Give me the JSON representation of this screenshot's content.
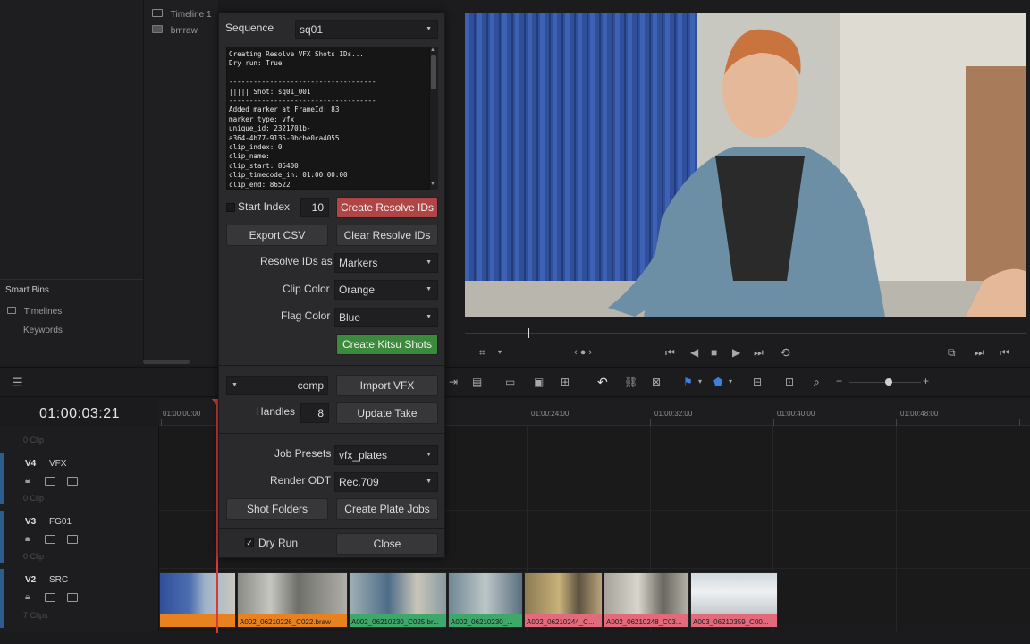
{
  "media_pool": {
    "top_items": [
      "Timeline 1",
      "bmraw"
    ],
    "smart_bins_title": "Smart Bins",
    "smart_bins": [
      "Timelines",
      "Keywords"
    ]
  },
  "dialog": {
    "sequence_label": "Sequence",
    "sequence_value": "sq01",
    "log_text": "Creating Resolve VFX Shots IDs...\nDry run: True\n\n------------------------------------\n||||| Shot: sq01_001\n------------------------------------\nAdded marker at FrameId: 83\nmarker_type: vfx\nunique_id: 2321701b-\na364-4b77-9135-0bcbe0ca4055\nclip_index: 0\nclip_name:\nclip_start: 86400\nclip_timecode_in: 01:00:00:00\nclip_end: 86522",
    "start_index_label": "Start Index",
    "start_index_value": "10",
    "create_resolve_ids_label": "Create Resolve IDs",
    "export_csv_label": "Export CSV",
    "clear_resolve_ids_label": "Clear Resolve IDs",
    "resolve_ids_as_label": "Resolve IDs as",
    "resolve_ids_as_value": "Markers",
    "clip_color_label": "Clip Color",
    "clip_color_value": "Orange",
    "flag_color_label": "Flag Color",
    "flag_color_value": "Blue",
    "create_kitsu_shots_label": "Create Kitsu Shots",
    "task_value": "comp",
    "import_vfx_label": "Import VFX",
    "handles_label": "Handles",
    "handles_value": "8",
    "update_take_label": "Update Take",
    "job_presets_label": "Job Presets",
    "job_presets_value": "vfx_plates",
    "render_odt_label": "Render ODT",
    "render_odt_value": "Rec.709",
    "shot_folders_label": "Shot Folders",
    "create_plate_jobs_label": "Create Plate Jobs",
    "dry_run_label": "Dry Run",
    "dry_run_check": "✓",
    "close_label": "Close",
    "colors": {
      "red_button": "#b04545",
      "green_button": "#3c8a3c"
    }
  },
  "timeline": {
    "timecode": "01:00:03:21",
    "ruler_labels": [
      "01:00:00:00",
      "01:00:24:00",
      "01:00:32:00",
      "01:00:40:00",
      "01:00:48:00"
    ],
    "clip_counts": [
      "0 Clip",
      "0 Clip",
      "0 Clip",
      "7 Clips"
    ],
    "tracks": [
      {
        "id": "V4",
        "name": "VFX"
      },
      {
        "id": "V3",
        "name": "FG01"
      },
      {
        "id": "V2",
        "name": "SRC"
      }
    ],
    "clips": [
      {
        "name": "",
        "color": "#e8821f"
      },
      {
        "name": "A002_06210226_C022.braw",
        "color": "#e8821f"
      },
      {
        "name": "A002_06210230_C025.br...",
        "color": "#3da86a"
      },
      {
        "name": "A002_06210230_...",
        "color": "#3da86a"
      },
      {
        "name": "A002_06210244_C...",
        "color": "#e26a7a"
      },
      {
        "name": "A002_06210248_C03...",
        "color": "#e26a7a"
      },
      {
        "name": "A003_06210359_C00...",
        "color": "#e26a7a"
      }
    ]
  }
}
